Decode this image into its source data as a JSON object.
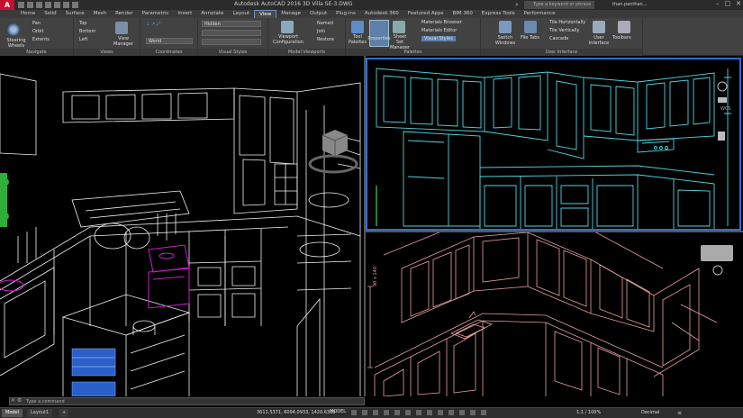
{
  "window": {
    "title": "Autodesk AutoCAD 2016    3D Villa SE-3.DWG",
    "search_placeholder": "Type a keyword or phrase",
    "user": "than.panthan..."
  },
  "ribbon_tabs": [
    "Home",
    "Solid",
    "Surface",
    "Mesh",
    "Render",
    "Parametric",
    "Insert",
    "Annotate",
    "Layout",
    "View",
    "Manage",
    "Output",
    "Plug-ins",
    "Autodesk 360",
    "Featured Apps",
    "BIM 360",
    "Express Tools",
    "Performance"
  ],
  "active_tab": "View",
  "panels": {
    "navigate": {
      "title": "Navigate",
      "steering": "Steering Wheels",
      "pan": "Pan",
      "orbit": "Orbit",
      "extents": "Extents"
    },
    "views": {
      "title": "Views",
      "top": "Top",
      "bottom": "Bottom",
      "left": "Left",
      "view_manager": "View Manager"
    },
    "coordinates": {
      "title": "Coordinates",
      "world": "World"
    },
    "visual_styles": {
      "title": "Visual Styles",
      "style": "Hidden"
    },
    "model_viewports": {
      "title": "Model Viewports",
      "viewport_config": "Viewport Configuration",
      "named": "Named",
      "join": "Join",
      "restore": "Restore"
    },
    "palettes": {
      "title": "Palettes",
      "tool_palettes": "Tool Palettes",
      "properties": "Properties",
      "sheet_set": "Sheet Set Manager",
      "materials_browser": "Materials Browser",
      "materials_editor": "Materials Editor",
      "visual_styles": "Visual Styles"
    },
    "user_interface": {
      "title": "User Interface",
      "switch_windows": "Switch Windows",
      "file_tabs": "File Tabs",
      "tile_h": "Tile Horizontally",
      "tile_v": "Tile Vertically",
      "cascade": "Cascade",
      "user_interface": "User Interface",
      "toolbars": "Toolbars"
    }
  },
  "viewports": {
    "tr_label": "WCS",
    "dims_text": "90 x 140"
  },
  "command": {
    "placeholder": "Type a command"
  },
  "status": {
    "model_tab": "Model",
    "layout_tab": "Layout1",
    "coords": "3611.5371, 6094.0933, 1420.6339",
    "model": "MODEL",
    "scale": "1:1 / 100%",
    "units": "Decimal"
  },
  "colors": {
    "viewport_active_border": "#2f6fd1",
    "cyan_lines": "#4dd6e0",
    "pink_lines": "#e8a0a0",
    "magenta": "#d01cd0",
    "blue_fill": "#2a5ec8",
    "green": "#2fae3a"
  }
}
